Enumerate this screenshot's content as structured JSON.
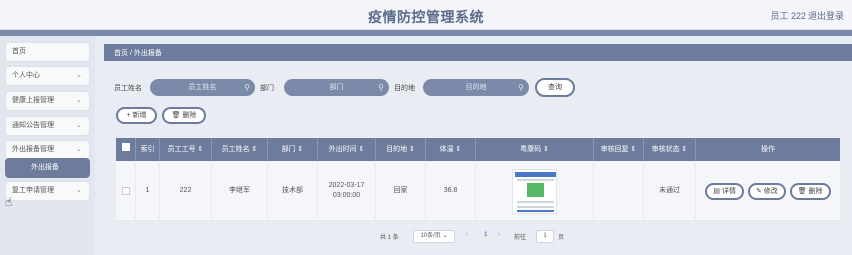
{
  "header": {
    "title": "疫情防控管理系统",
    "user": "员工 222",
    "logout": "退出登录"
  },
  "sidebar": {
    "items": [
      {
        "label": "首页",
        "has_chevron": false
      },
      {
        "label": "个人中心"
      },
      {
        "label": "健康上报管理"
      },
      {
        "label": "通知公告管理"
      },
      {
        "label": "外出报备管理"
      },
      {
        "label": "外出报备",
        "active": true
      },
      {
        "label": "复工申请管理"
      }
    ],
    "chevron": "⌄"
  },
  "breadcrumb": {
    "text": "首页 / 外出报备"
  },
  "search": {
    "name_label": "员工姓名",
    "name_placeholder": "员工姓名",
    "dept_label": "部门",
    "dept_placeholder": "部门",
    "dest_label": "目的地",
    "dest_placeholder": "目的地",
    "query_label": "查询",
    "search_icon": "⚲"
  },
  "toolbar": {
    "add_label": "+ 新增",
    "delete_label": "🗑 删除"
  },
  "table": {
    "headers": [
      "索引",
      "员工工号 ⇕",
      "员工姓名 ⇕",
      "部门 ⇕",
      "外出时间 ⇕",
      "目的地 ⇕",
      "体温 ⇕",
      "粤康码 ⇕",
      "审核回复 ⇕",
      "审核状态 ⇕",
      "操作"
    ],
    "rows": [
      {
        "index": "1",
        "emp_no": "222",
        "emp_name": "李继军",
        "dept": "技术部",
        "out_time": "2022-03-17 03:00:00",
        "destination": "回家",
        "temperature": "36.8",
        "reply": "",
        "status": "未通过"
      }
    ],
    "ops": {
      "detail": "▤ 详情",
      "edit": "✎ 修改",
      "delete": "🗑 删除"
    }
  },
  "pagination": {
    "total": "共 1 条",
    "page_size": "10条/页 ⌄",
    "prev": "‹",
    "current": "1",
    "next": "›",
    "goto_label": "前往",
    "goto_value": "1",
    "page_suffix": "页"
  }
}
